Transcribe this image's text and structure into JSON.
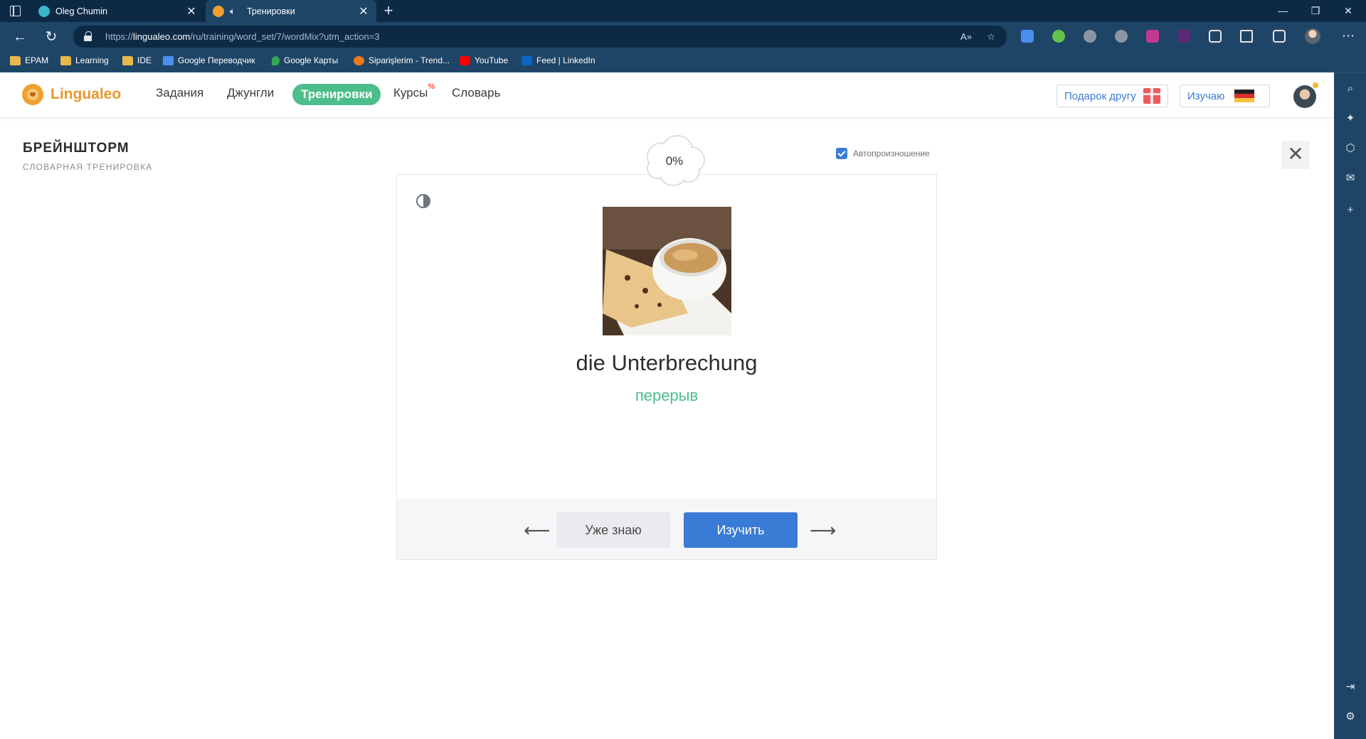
{
  "browser": {
    "tabs": [
      {
        "title": "Oleg Chumin",
        "active": false
      },
      {
        "title": "Тренировки",
        "active": true
      }
    ],
    "url_prefix": "https://",
    "url_host": "lingualeo.com",
    "url_path": "/ru/training/word_set/7/wordMix?utm_action=3",
    "bookmarks": [
      {
        "label": "EPAM",
        "icon": "folder-icon"
      },
      {
        "label": "Learning",
        "icon": "folder-icon"
      },
      {
        "label": "IDE",
        "icon": "folder-icon"
      },
      {
        "label": "Google Переводчик",
        "icon": "google-translate-icon"
      },
      {
        "label": "Google Карты",
        "icon": "google-maps-icon"
      },
      {
        "label": "Siparişlerim - Trend...",
        "icon": "trendyol-icon"
      },
      {
        "label": "YouTube",
        "icon": "youtube-icon"
      },
      {
        "label": "Feed | LinkedIn",
        "icon": "linkedin-icon"
      }
    ]
  },
  "site": {
    "logo_text": "Lingualeo",
    "nav": [
      "Задания",
      "Джунгли",
      "Тренировки",
      "Курсы",
      "Словарь"
    ],
    "nav_active": "Тренировки",
    "courses_badge": "%",
    "gift_button": "Подарок другу",
    "learning_button": "Изучаю",
    "accent": "#4cbe8c",
    "primary": "#3a7bd5"
  },
  "training": {
    "title": "БРЕЙНШТОРМ",
    "subtitle": "СЛОВАРНАЯ ТРЕНИРОВКА",
    "autopronounce_label": "Автопроизношение",
    "autopronounce_checked": true,
    "progress_label": "0%",
    "progress": 0,
    "word": "die Unterbrechung",
    "translation": "перерыв",
    "know_button": "Уже знаю",
    "learn_button": "Изучить",
    "prev_arrow": "⟵",
    "next_arrow": "⟶"
  }
}
